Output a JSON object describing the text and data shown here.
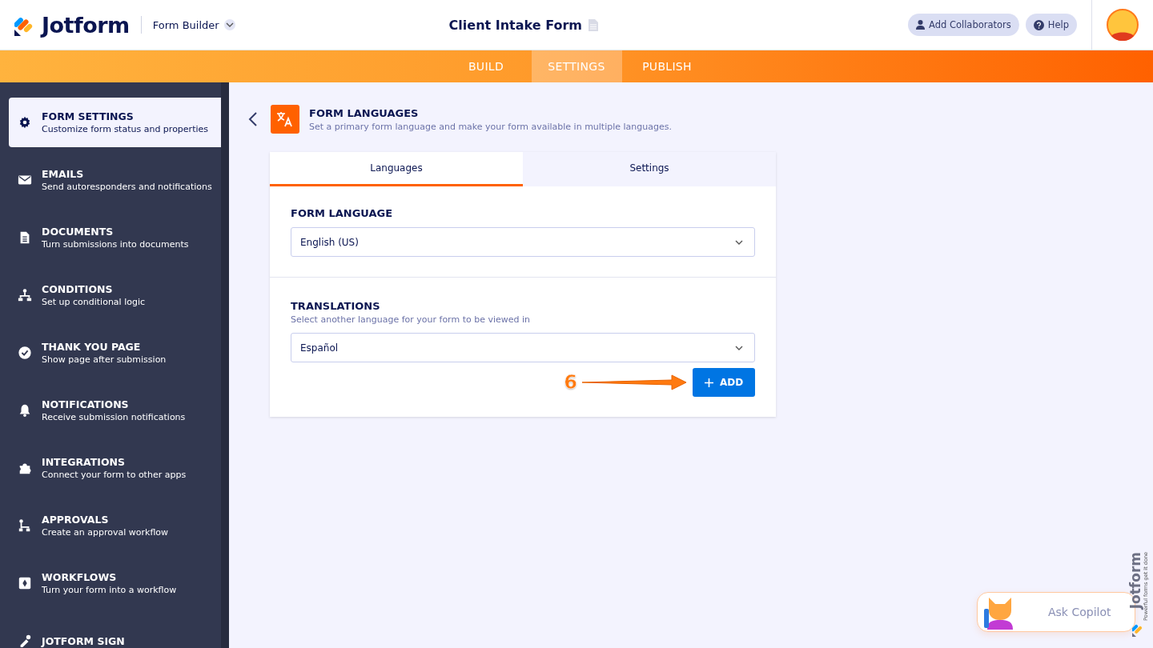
{
  "header": {
    "logo": "Jotform",
    "app_switcher": "Form Builder",
    "form_title": "Client Intake Form",
    "buttons": [
      "Add Collaborators",
      "Help"
    ]
  },
  "nav_tabs": [
    {
      "label": "BUILD",
      "selected": false
    },
    {
      "label": "SETTINGS",
      "selected": true
    },
    {
      "label": "PUBLISH",
      "selected": false
    }
  ],
  "sidebar": {
    "items": [
      {
        "title": "FORM SETTINGS",
        "description": "Customize form status and properties",
        "selected": true
      },
      {
        "title": "EMAILS",
        "description": "Send autoresponders and notifications",
        "selected": false
      },
      {
        "title": "DOCUMENTS",
        "description": "Turn submissions into documents",
        "selected": false
      },
      {
        "title": "CONDITIONS",
        "description": "Set up conditional logic",
        "selected": false
      },
      {
        "title": "THANK YOU PAGE",
        "description": "Show page after submission",
        "selected": false
      },
      {
        "title": "NOTIFICATIONS",
        "description": "Receive submission notifications",
        "selected": false
      },
      {
        "title": "INTEGRATIONS",
        "description": "Connect your form to other apps",
        "selected": false
      },
      {
        "title": "APPROVALS",
        "description": "Create an approval workflow",
        "selected": false
      },
      {
        "title": "WORKFLOWS",
        "description": "Turn your form into a workflow",
        "selected": false
      },
      {
        "title": "JOTFORM SIGN",
        "selected": false
      }
    ]
  },
  "panel": {
    "title": "FORM LANGUAGES",
    "subtitle": "Set a primary form language and make your form available in multiple languages.",
    "tabs": [
      {
        "label": "Languages",
        "selected": true
      },
      {
        "label": "Settings",
        "selected": false
      }
    ],
    "form_language": {
      "label": "FORM LANGUAGE",
      "value": "English (US)"
    },
    "translations": {
      "label": "TRANSLATIONS",
      "hint": "Select another language for your form to be viewed in",
      "value": "Español",
      "button": "ADD"
    },
    "annotation": "6"
  },
  "copilot": {
    "label": "Ask Copilot"
  },
  "badge": {
    "name": "Jotform",
    "tagline": "Powerful forms get it done"
  }
}
